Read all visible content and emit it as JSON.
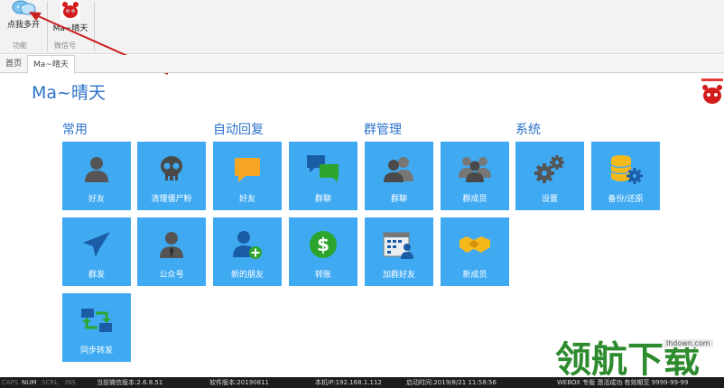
{
  "ribbon": {
    "btn_find": "点我多开",
    "btn_account": "Ma~晴天",
    "group_func": "功能",
    "group_wechat": "微信号"
  },
  "tabs": [
    {
      "label": "首页"
    },
    {
      "label": "Ma~晴天"
    }
  ],
  "main": {
    "title": "Ma~晴天"
  },
  "sections": {
    "common": "常用",
    "auto_reply": "自动回复",
    "group_mgmt": "群管理",
    "system": "系统"
  },
  "tiles": {
    "friends": "好友",
    "clean_zombie": "清理僵尸粉",
    "auto_friends": "好友",
    "auto_group_chat": "群聊",
    "group_chat": "群聊",
    "group_members": "群成员",
    "settings": "设置",
    "backup": "备份/还原",
    "mass_send": "群发",
    "official_account": "公众号",
    "new_friends": "新的朋友",
    "transfer": "转账",
    "add_group_friends": "加群好友",
    "new_members": "新成员",
    "sync_forward": "同步转发"
  },
  "status": {
    "caps": "CAPS",
    "num": "NUM",
    "scrl": "SCRL",
    "ins": "INS",
    "wechat_version": "当前微信版本:2.6.8.51",
    "software_version": "软件版本:20190811",
    "local_ip": "本机IP:192.168.1.112",
    "start_time": "启动时间:2019/8/21 11:58:56",
    "license": "WEBOX 专版 激活成功 有效期至 9999-99-99"
  },
  "watermark": {
    "text": "领航下载",
    "site": "lhdown.com"
  },
  "colors": {
    "tile": "#3faaf2",
    "title": "#2a72c9",
    "status_bg": "#1d1d1d"
  }
}
